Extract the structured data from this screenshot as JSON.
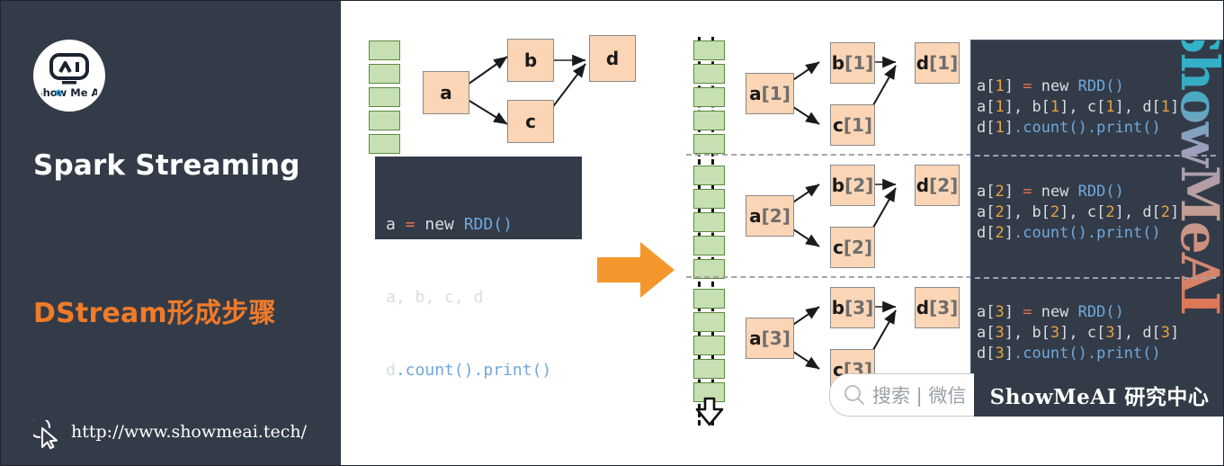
{
  "cover": {
    "logo_icon": "show-me-ai-logo",
    "logo_text": "Show Me AI",
    "title": "Spark Streaming",
    "subtitle": "DStream形成步骤",
    "url": "http://www.showmeai.tech/",
    "cursor_icon": "cursor-pointer-icon",
    "bg_color": "#333b48",
    "accent_color": "#f07b29"
  },
  "left_diagram": {
    "stream_blocks_count": 5,
    "nodes": [
      {
        "id": "a",
        "label": "a",
        "index": ""
      },
      {
        "id": "b",
        "label": "b",
        "index": ""
      },
      {
        "id": "c",
        "label": "c",
        "index": ""
      },
      {
        "id": "d",
        "label": "d",
        "index": ""
      }
    ],
    "edges": [
      [
        "a",
        "b"
      ],
      [
        "a",
        "c"
      ],
      [
        "b",
        "d"
      ],
      [
        "c",
        "d"
      ]
    ],
    "code": {
      "line1": {
        "var": "a",
        "eq": " = ",
        "new": "new ",
        "cls": "RDD()"
      },
      "line2": "a, b, c, d",
      "line3": {
        "var": "d",
        "call1": ".count()",
        "call2": ".print()"
      }
    }
  },
  "transition": {
    "arrow_icon": "right-arrow-icon",
    "arrow_color": "#f5962d"
  },
  "right_diagram": {
    "groups": [
      {
        "index": "1",
        "stream_blocks_count": 5,
        "nodes": [
          {
            "id": "a",
            "label": "a",
            "index": "[1]"
          },
          {
            "id": "b",
            "label": "b",
            "index": "[1]"
          },
          {
            "id": "c",
            "label": "c",
            "index": "[1]"
          },
          {
            "id": "d",
            "label": "d",
            "index": "[1]"
          }
        ],
        "code": {
          "line1": "a[1] = new RDD()",
          "line2": "a[1], b[1], c[1], d[1]",
          "line3": "d[1].count().print()"
        }
      },
      {
        "index": "2",
        "stream_blocks_count": 5,
        "nodes": [
          {
            "id": "a",
            "label": "a",
            "index": "[2]"
          },
          {
            "id": "b",
            "label": "b",
            "index": "[2]"
          },
          {
            "id": "c",
            "label": "c",
            "index": "[2]"
          },
          {
            "id": "d",
            "label": "d",
            "index": "[2]"
          }
        ],
        "code": {
          "line1": "a[2] = new RDD()",
          "line2": "a[2], b[2], c[2], d[2]",
          "line3": "d[2].count().print()"
        }
      },
      {
        "index": "3",
        "stream_blocks_count": 5,
        "nodes": [
          {
            "id": "a",
            "label": "a",
            "index": "[3]"
          },
          {
            "id": "b",
            "label": "b",
            "index": "[3]"
          },
          {
            "id": "c",
            "label": "c",
            "index": "[3]"
          },
          {
            "id": "d",
            "label": "d",
            "index": "[3]"
          }
        ],
        "code": {
          "line1": "a[3] = new RDD()",
          "line2": "a[3], b[3], c[3], d[3]",
          "line3": "d[3].count().print()"
        }
      }
    ],
    "watermark_text": "ShowMeAI",
    "stream_arrow_icon": "down-arrow-icon"
  },
  "footer": {
    "search_icon": "search-icon",
    "search_text": "搜索 | 微信",
    "brand_text": "ShowMeAI 研究中心"
  },
  "colors": {
    "node_fill": "#fbd5b5",
    "node_border": "#8a8a8a",
    "block_fill": "#c6e0b4",
    "block_border": "#5b8a3c",
    "code_bg": "#333b48"
  }
}
